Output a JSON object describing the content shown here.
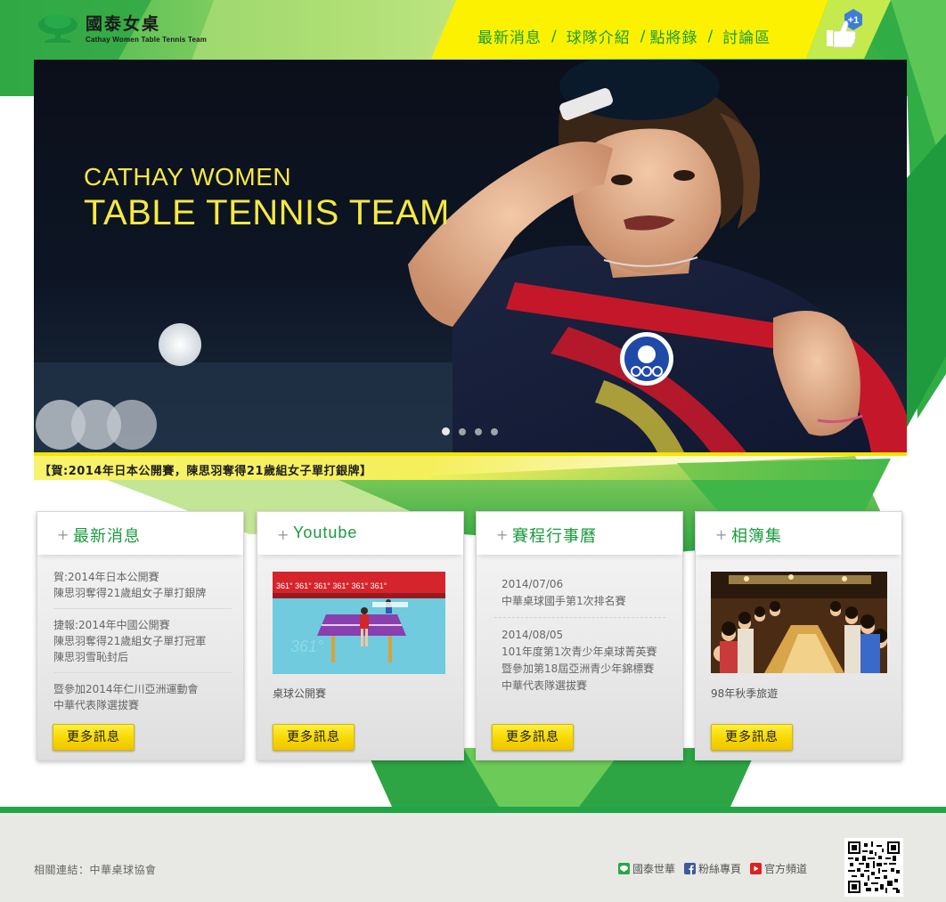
{
  "logo": {
    "title": "國泰女桌",
    "subtitle": "Cathay Women Table Tennis Team"
  },
  "nav": {
    "items": [
      "最新消息",
      "球隊介紹",
      "點將錄",
      "討論區"
    ],
    "separator": "/"
  },
  "like_badge": {
    "label": "+1",
    "icon": "thumbs-up-icon"
  },
  "hero": {
    "line1": "CATHAY WOMEN",
    "line2": "TABLE TENNIS TEAM",
    "slides_total": 4,
    "slide_active": 1
  },
  "ticker": {
    "text": "【賀:2014年日本公開賽，陳思羽奪得21歲組女子單打銀牌】"
  },
  "cards": {
    "news": {
      "title": "最新消息",
      "items": [
        [
          "賀:2014年日本公開賽",
          "陳思羽奪得21歲組女子單打銀牌"
        ],
        [
          "捷報:2014年中國公開賽",
          "陳思羽奪得21歲組女子單打冠軍",
          "陳思羽雪恥封后"
        ],
        [
          "暨參加2014年仁川亞洲運動會",
          "中華代表隊選拔賽"
        ]
      ],
      "more": "更多訊息"
    },
    "youtube": {
      "title": "Youtube",
      "caption": "桌球公開賽",
      "more": "更多訊息"
    },
    "schedule": {
      "title": "賽程行事曆",
      "items": [
        {
          "date": "2014/07/06",
          "lines": [
            "中華桌球國手第1次排名賽"
          ]
        },
        {
          "date": "2014/08/05",
          "lines": [
            "101年度第1次青少年桌球菁英賽",
            "暨參加第18屆亞洲青少年錦標賽",
            "中華代表隊選拔賽"
          ]
        }
      ],
      "more": "更多訊息"
    },
    "album": {
      "title": "相簿集",
      "caption": "98年秋季旅遊",
      "more": "更多訊息"
    },
    "plus": "+"
  },
  "footer": {
    "related_label": "相關連結：",
    "related_link": "中華桌球協會",
    "links": [
      {
        "label": "國泰世華",
        "icon": "cathay-icon"
      },
      {
        "label": "粉絲專頁",
        "icon": "facebook-icon"
      },
      {
        "label": "官方頻道",
        "icon": "youtube-icon"
      }
    ]
  },
  "colors": {
    "brand_green": "#1a9b3c",
    "accent_yellow": "#f5e400",
    "footer_bar": "#22a447"
  }
}
